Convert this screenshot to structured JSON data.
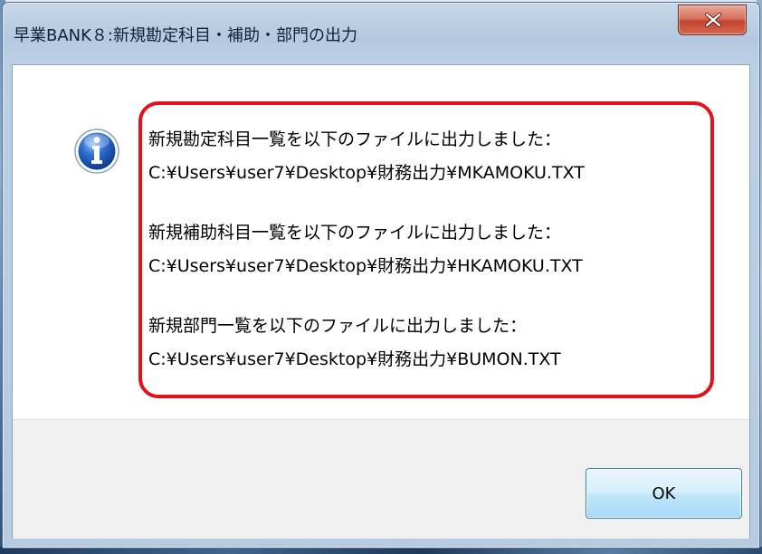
{
  "window": {
    "title": "早業BANK８:新規勘定科目・補助・部門の出力"
  },
  "icon": {
    "type": "information-icon"
  },
  "message": {
    "line1": "新規勘定科目一覧を以下のファイルに出力しました：",
    "line2": "C:¥Users¥user7¥Desktop¥財務出力¥MKAMOKU.TXT",
    "line3": "新規補助科目一覧を以下のファイルに出力しました：",
    "line4": "C:¥Users¥user7¥Desktop¥財務出力¥HKAMOKU.TXT",
    "line5": "新規部門一覧を以下のファイルに出力しました：",
    "line6": "C:¥Users¥user7¥Desktop¥財務出力¥BUMON.TXT"
  },
  "buttons": {
    "ok_label": "OK"
  },
  "colors": {
    "highlight_frame": "#e2121d",
    "close_button": "#c2432e",
    "ok_button": "#bee6fd"
  }
}
